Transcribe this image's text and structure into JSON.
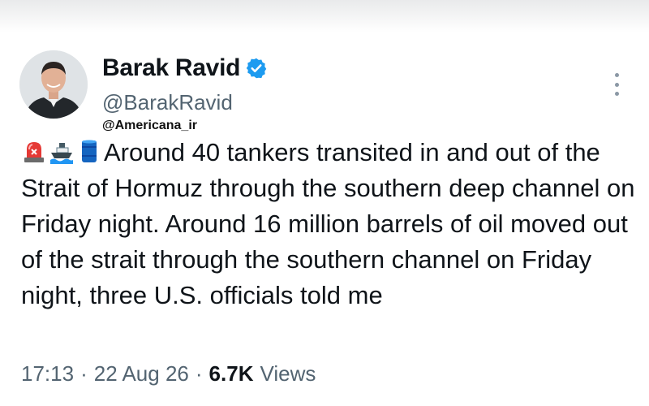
{
  "tweet": {
    "author_name": "Barak Ravid",
    "handle": "@BarakRavid",
    "watermark": "@Americana_ir",
    "emojis": [
      "rotating-light-icon",
      "ship-icon",
      "oil-drum-icon"
    ],
    "text": "Around 40 tankers transited in and out of the Strait of Hormuz through the southern deep channel on Friday night. Around 16 million barrels of oil moved out of the strait through the southern channel on Friday night, three U.S. officials told me",
    "time": "17:13",
    "date": "22 Aug 26",
    "views_count": "6.7K",
    "views_label": "Views",
    "separator": "·"
  },
  "colors": {
    "verified": "#1d9bf0",
    "text": "#0f1419",
    "muted": "#536471"
  }
}
